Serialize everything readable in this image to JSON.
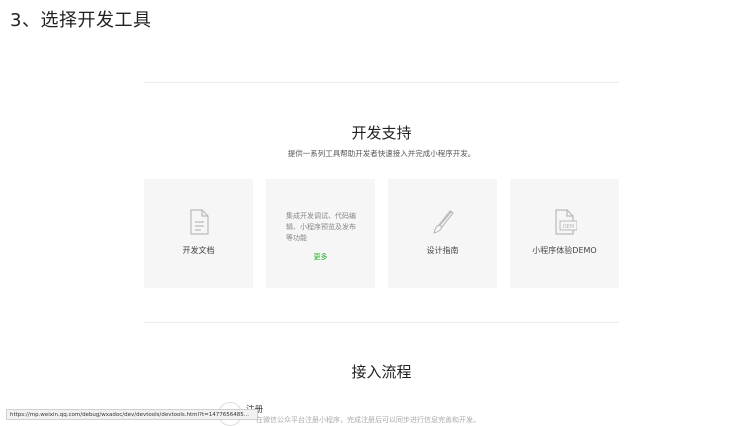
{
  "step_title": "3、选择开发工具",
  "support": {
    "title": "开发支持",
    "subtitle": "提供一系列工具帮助开发者快速接入并完成小程序开发。",
    "cards": [
      {
        "label": "开发文档",
        "icon": "document-icon"
      },
      {
        "description": "集成开发调试、代码编辑、小程序预览及发布等功能",
        "more": "更多"
      },
      {
        "label": "设计指南",
        "icon": "brush-icon"
      },
      {
        "label": "小程序体验DEMO",
        "icon": "demo-icon"
      }
    ]
  },
  "flow": {
    "title": "接入流程",
    "steps": [
      {
        "name": "注册",
        "text": "在微信公众平台注册小程序，完成注册后可以同步进行信息完善和开发。"
      }
    ]
  },
  "status_bar": {
    "url": "https://mp.weixin.qq.com/debug/wxadoc/dev/devtools/devtools.html?t=1477656485..."
  },
  "colors": {
    "link_green": "#1aad19",
    "card_bg": "#f6f6f6"
  }
}
